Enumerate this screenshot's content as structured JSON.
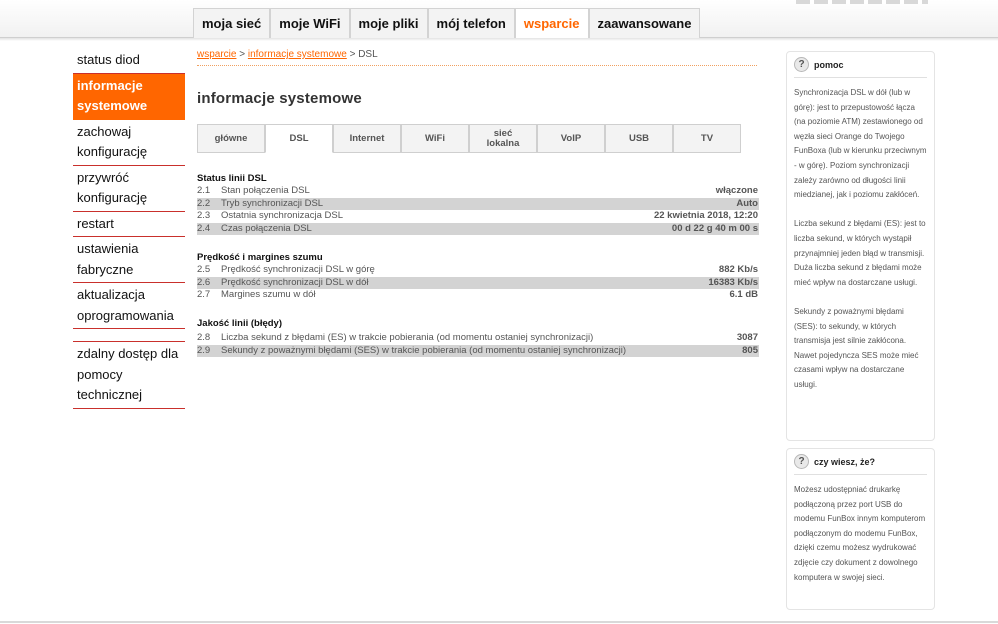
{
  "main_nav": [
    {
      "label": "moja sieć",
      "active": false
    },
    {
      "label": "moje WiFi",
      "active": false
    },
    {
      "label": "moje pliki",
      "active": false
    },
    {
      "label": "mój telefon",
      "active": false
    },
    {
      "label": "wsparcie",
      "active": true
    },
    {
      "label": "zaawansowane",
      "active": false
    }
  ],
  "sidebar": {
    "items": [
      {
        "label": "status diod"
      },
      {
        "label": "informacje systemowe"
      },
      {
        "label": "zachowaj konfigurację"
      },
      {
        "label": "przywróć konfigurację"
      },
      {
        "label": "restart"
      },
      {
        "label": "ustawienia fabryczne"
      },
      {
        "label": "aktualizacja oprogramowania"
      },
      {
        "label": "zdalny dostęp dla pomocy technicznej"
      }
    ]
  },
  "breadcrumb": {
    "link1": "wsparcie",
    "sep1": " > ",
    "link2": "informacje systemowe",
    "sep2": " > ",
    "current": "DSL"
  },
  "page_title": "informacje systemowe",
  "subtabs": [
    {
      "label": "główne"
    },
    {
      "label": "DSL"
    },
    {
      "label": "Internet"
    },
    {
      "label": "WiFi"
    },
    {
      "label": "sieć lokalna"
    },
    {
      "label": "VoIP"
    },
    {
      "label": "USB"
    },
    {
      "label": "TV"
    }
  ],
  "sections": {
    "status": {
      "title": "Status linii DSL",
      "rows": [
        {
          "num": "2.1",
          "label": "Stan połączenia DSL",
          "value": "włączone"
        },
        {
          "num": "2.2",
          "label": "Tryb synchronizacji DSL",
          "value": "Auto"
        },
        {
          "num": "2.3",
          "label": "Ostatnia synchronizacja DSL",
          "value": "22 kwietnia 2018, 12:20"
        },
        {
          "num": "2.4",
          "label": "Czas połączenia DSL",
          "value": "00 d 22 g 40 m 00 s"
        }
      ]
    },
    "speed": {
      "title": "Prędkość i margines szumu",
      "rows": [
        {
          "num": "2.5",
          "label": "Prędkość synchronizacji DSL w górę",
          "value": "882 Kb/s"
        },
        {
          "num": "2.6",
          "label": "Prędkość synchronizacji DSL w dół",
          "value": "16383 Kb/s"
        },
        {
          "num": "2.7",
          "label": "Margines szumu w dół",
          "value": "6.1 dB"
        }
      ]
    },
    "quality": {
      "title": "Jakość linii (błędy)",
      "rows": [
        {
          "num": "2.8",
          "label": "Liczba sekund z błędami (ES) w trakcie pobierania (od momentu ostaniej synchronizacji)",
          "value": "3087"
        },
        {
          "num": "2.9",
          "label": "Sekundy z poważnymi błędami (SES) w trakcie pobierania (od momentu ostaniej synchronizacji)",
          "value": "805"
        }
      ]
    }
  },
  "help": {
    "title": "pomoc",
    "icon_char": "?",
    "p1": "Synchronizacja DSL w dół (lub w górę): jest to przepustowość łącza (na poziomie ATM) zestawionego od węzła sieci Orange do Twojego FunBoxa (lub w kierunku przeciwnym - w górę). Poziom synchronizacji zależy zarówno od długości linii miedzianej, jak i poziomu zakłóceń.",
    "p2": "Liczba sekund z błędami (ES): jest to liczba sekund, w których wystąpił przynajmniej jeden błąd w transmisji. Duża liczba sekund z błędami może mieć wpływ na dostarczane usługi.",
    "p3": "Sekundy z poważnymi błędami (SES): to sekundy, w których transmisja jest silnie zakłócona. Nawet pojedyncza SES może mieć czasami wpływ na dostarczane usługi."
  },
  "tip": {
    "title": "czy wiesz, że?",
    "icon_char": "?",
    "p1": "Możesz udostępniać drukarkę podłączoną przez port USB do modemu FunBox innym komputerom podłączonym do modemu FunBox, dzięki czemu możesz wydrukować zdjęcie czy dokument z dowolnego komputera w swojej sieci."
  },
  "colors": {
    "accent": "#ff6600",
    "sidebar_divider": "#c9302c",
    "row_shade": "#d3d3d3"
  }
}
